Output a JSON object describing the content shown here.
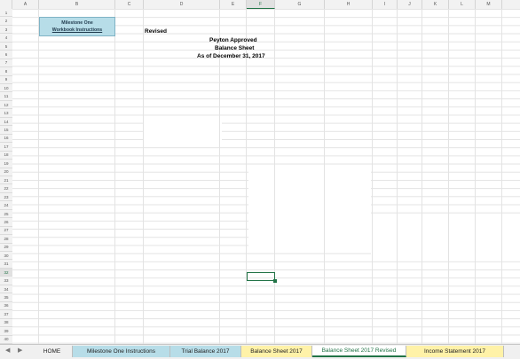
{
  "columns": [
    "A",
    "B",
    "C",
    "D",
    "E",
    "F",
    "G",
    "H",
    "I",
    "J",
    "K",
    "L",
    "M"
  ],
  "rows": [
    "1",
    "2",
    "3",
    "4",
    "5",
    "6",
    "7",
    "8",
    "9",
    "10",
    "11",
    "12",
    "13",
    "14",
    "15",
    "16",
    "17",
    "18",
    "19",
    "20",
    "21",
    "22",
    "23",
    "24",
    "25",
    "26",
    "27",
    "28",
    "29",
    "30",
    "31",
    "32",
    "33",
    "34",
    "35",
    "36",
    "37",
    "38",
    "39",
    "40"
  ],
  "selected_column": "F",
  "selected_row": "32",
  "milestone_button": {
    "line1": "Milestone One",
    "line2": "Workbook Instructions"
  },
  "cells": {
    "revised": "Revised",
    "company": "Peyton Approved",
    "statement": "Balance Sheet",
    "date": "As of December 31, 2017"
  },
  "tabs": [
    {
      "label": "HOME",
      "color": "#f0f0f0"
    },
    {
      "label": "Milestone One Instructions",
      "color": "#b7dde8"
    },
    {
      "label": "Trial Balance 2017",
      "color": "#b7dde8"
    },
    {
      "label": "Balance Sheet 2017",
      "color": "#fff2a8"
    },
    {
      "label": "Balance Sheet 2017 Revised",
      "color": "#ffffff"
    },
    {
      "label": "Income Statement 2017",
      "color": "#fff2a8"
    }
  ],
  "nav": {
    "prev": "◀",
    "next": "▶"
  }
}
